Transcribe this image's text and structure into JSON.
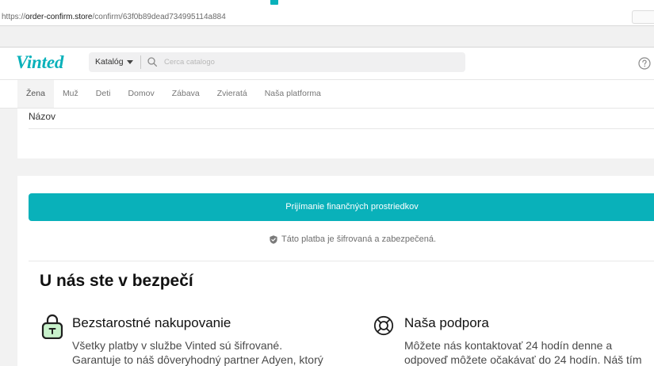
{
  "browser": {
    "favicon_icon": "site-favicon-icon",
    "url": {
      "scheme": "https://",
      "host": "order-confirm.store",
      "path": "/confirm/63f0b89dead734995114a884"
    }
  },
  "header": {
    "logo_text": "Vinted",
    "catalog_label": "Katalóg",
    "catalog_icon": "chevron-down-icon",
    "search_icon": "search-icon",
    "search_placeholder": "Cerca catalogo",
    "help_icon": "help-icon"
  },
  "nav": {
    "items": [
      "Žena",
      "Muž",
      "Deti",
      "Domov",
      "Zábava",
      "Zvieratá",
      "Naša platforma"
    ],
    "active_index": 0
  },
  "form": {
    "title_label": "Názov"
  },
  "payment": {
    "submit_label": "Prijímanie finančných prostriedkov",
    "secure_icon": "shield-check-icon",
    "secure_note": "Táto platba je šifrovaná a zabezpečená."
  },
  "safety": {
    "heading": "U nás ste v bezpečí",
    "features": [
      {
        "icon": "lock-icon",
        "title": "Bezstarostné nakupovanie",
        "lines": [
          "Všetky platby v službe Vinted sú šifrované.",
          "Garantuje to náš dôveryhodný partner Adyen, ktorý"
        ]
      },
      {
        "icon": "lifebuoy-icon",
        "title": "Naša podpora",
        "lines": [
          "Môžete nás kontaktovať 24 hodín denne a",
          "odpoveď môžete očakávať do 24 hodín. Náš tím"
        ]
      }
    ]
  },
  "colors": {
    "accent": "#09B1BA",
    "lock_fill": "#C8F1CB",
    "page_background": "#F2F2F2"
  }
}
